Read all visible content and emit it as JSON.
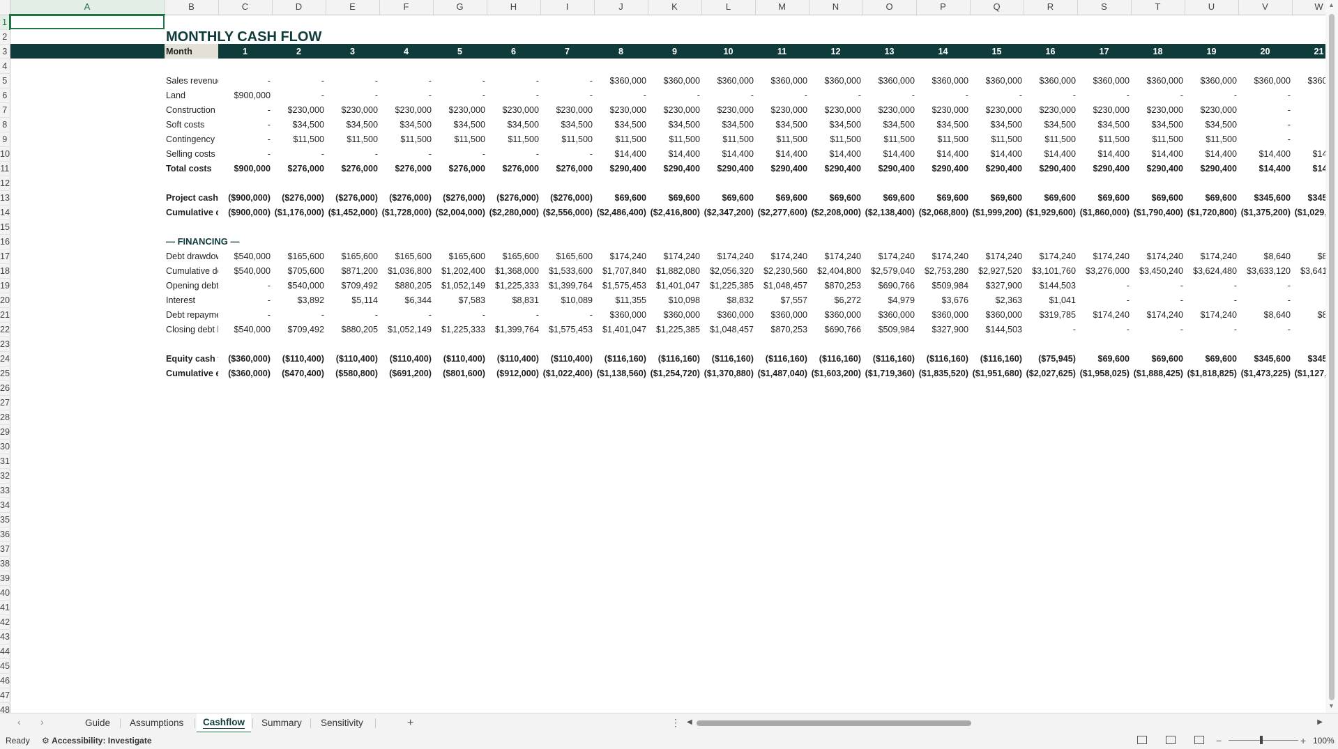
{
  "columns": [
    "A",
    "B",
    "C",
    "D",
    "E",
    "F",
    "G",
    "H",
    "I",
    "J",
    "K",
    "L",
    "M",
    "N",
    "O",
    "P",
    "Q",
    "R",
    "S",
    "T",
    "U",
    "V",
    "W"
  ],
  "title": "MONTHLY CASH FLOW",
  "header": {
    "label": "Month",
    "values": [
      "1",
      "2",
      "3",
      "4",
      "5",
      "6",
      "7",
      "8",
      "9",
      "10",
      "11",
      "12",
      "13",
      "14",
      "15",
      "16",
      "17",
      "18",
      "19",
      "20",
      "21"
    ],
    "overflow": ""
  },
  "rows": {
    "r5": {
      "label": "Sales revenue",
      "values": [
        "-",
        "-",
        "-",
        "-",
        "-",
        "-",
        "-",
        "$360,000",
        "$360,000",
        "$360,000",
        "$360,000",
        "$360,000",
        "$360,000",
        "$360,000",
        "$360,000",
        "$360,000",
        "$360,000",
        "$360,000",
        "$360,000",
        "$360,000",
        "$360,000"
      ],
      "overflow": "$3"
    },
    "r6": {
      "label": "Land",
      "values": [
        "$900,000",
        "-",
        "-",
        "-",
        "-",
        "-",
        "-",
        "-",
        "-",
        "-",
        "-",
        "-",
        "-",
        "-",
        "-",
        "-",
        "-",
        "-",
        "-",
        "-",
        "-"
      ],
      "overflow": ""
    },
    "r7": {
      "label": "Construction",
      "values": [
        "-",
        "$230,000",
        "$230,000",
        "$230,000",
        "$230,000",
        "$230,000",
        "$230,000",
        "$230,000",
        "$230,000",
        "$230,000",
        "$230,000",
        "$230,000",
        "$230,000",
        "$230,000",
        "$230,000",
        "$230,000",
        "$230,000",
        "$230,000",
        "$230,000",
        "-",
        "-"
      ],
      "overflow": ""
    },
    "r8": {
      "label": "Soft costs",
      "values": [
        "-",
        "$34,500",
        "$34,500",
        "$34,500",
        "$34,500",
        "$34,500",
        "$34,500",
        "$34,500",
        "$34,500",
        "$34,500",
        "$34,500",
        "$34,500",
        "$34,500",
        "$34,500",
        "$34,500",
        "$34,500",
        "$34,500",
        "$34,500",
        "$34,500",
        "-",
        "-"
      ],
      "overflow": ""
    },
    "r9": {
      "label": "Contingency",
      "values": [
        "-",
        "$11,500",
        "$11,500",
        "$11,500",
        "$11,500",
        "$11,500",
        "$11,500",
        "$11,500",
        "$11,500",
        "$11,500",
        "$11,500",
        "$11,500",
        "$11,500",
        "$11,500",
        "$11,500",
        "$11,500",
        "$11,500",
        "$11,500",
        "$11,500",
        "-",
        "-"
      ],
      "overflow": ""
    },
    "r10": {
      "label": "Selling costs",
      "values": [
        "-",
        "-",
        "-",
        "-",
        "-",
        "-",
        "-",
        "$14,400",
        "$14,400",
        "$14,400",
        "$14,400",
        "$14,400",
        "$14,400",
        "$14,400",
        "$14,400",
        "$14,400",
        "$14,400",
        "$14,400",
        "$14,400",
        "$14,400",
        "$14,400"
      ],
      "overflow": "$"
    },
    "r11": {
      "label": "Total costs",
      "values": [
        "$900,000",
        "$276,000",
        "$276,000",
        "$276,000",
        "$276,000",
        "$276,000",
        "$276,000",
        "$290,400",
        "$290,400",
        "$290,400",
        "$290,400",
        "$290,400",
        "$290,400",
        "$290,400",
        "$290,400",
        "$290,400",
        "$290,400",
        "$290,400",
        "$290,400",
        "$14,400",
        "$14,400"
      ],
      "overflow": "$"
    },
    "r13": {
      "label": "Project cash flow (unlevered)",
      "values": [
        "($900,000)",
        "($276,000)",
        "($276,000)",
        "($276,000)",
        "($276,000)",
        "($276,000)",
        "($276,000)",
        "$69,600",
        "$69,600",
        "$69,600",
        "$69,600",
        "$69,600",
        "$69,600",
        "$69,600",
        "$69,600",
        "$69,600",
        "$69,600",
        "$69,600",
        "$69,600",
        "$345,600",
        "$345,600"
      ],
      "overflow": "$3"
    },
    "r14": {
      "label": "Cumulative cash flow (project)",
      "values": [
        "($900,000)",
        "($1,176,000)",
        "($1,452,000)",
        "($1,728,000)",
        "($2,004,000)",
        "($2,280,000)",
        "($2,556,000)",
        "($2,486,400)",
        "($2,416,800)",
        "($2,347,200)",
        "($2,277,600)",
        "($2,208,000)",
        "($2,138,400)",
        "($2,068,800)",
        "($1,999,200)",
        "($1,929,600)",
        "($1,860,000)",
        "($1,790,400)",
        "($1,720,800)",
        "($1,375,200)",
        "($1,029,600)"
      ],
      "overflow": "($6"
    },
    "r16": {
      "label": "— FINANCING —"
    },
    "r17": {
      "label": "Debt drawdown",
      "values": [
        "$540,000",
        "$165,600",
        "$165,600",
        "$165,600",
        "$165,600",
        "$165,600",
        "$165,600",
        "$174,240",
        "$174,240",
        "$174,240",
        "$174,240",
        "$174,240",
        "$174,240",
        "$174,240",
        "$174,240",
        "$174,240",
        "$174,240",
        "$174,240",
        "$174,240",
        "$8,640",
        "$8,640"
      ],
      "overflow": ""
    },
    "r18": {
      "label": "Cumulative debt drawn",
      "values": [
        "$540,000",
        "$705,600",
        "$871,200",
        "$1,036,800",
        "$1,202,400",
        "$1,368,000",
        "$1,533,600",
        "$1,707,840",
        "$1,882,080",
        "$2,056,320",
        "$2,230,560",
        "$2,404,800",
        "$2,579,040",
        "$2,753,280",
        "$2,927,520",
        "$3,101,760",
        "$3,276,000",
        "$3,450,240",
        "$3,624,480",
        "$3,633,120",
        "$3,641,760"
      ],
      "overflow": "$3,6"
    },
    "r19": {
      "label": "Opening debt balance",
      "values": [
        "-",
        "$540,000",
        "$709,492",
        "$880,205",
        "$1,052,149",
        "$1,225,333",
        "$1,399,764",
        "$1,575,453",
        "$1,401,047",
        "$1,225,385",
        "$1,048,457",
        "$870,253",
        "$690,766",
        "$509,984",
        "$327,900",
        "$144,503",
        "-",
        "-",
        "-",
        "-",
        "-"
      ],
      "overflow": ""
    },
    "r20": {
      "label": "Interest",
      "values": [
        "-",
        "$3,892",
        "$5,114",
        "$6,344",
        "$7,583",
        "$8,831",
        "$10,089",
        "$11,355",
        "$10,098",
        "$8,832",
        "$7,557",
        "$6,272",
        "$4,979",
        "$3,676",
        "$2,363",
        "$1,041",
        "-",
        "-",
        "-",
        "-",
        "-"
      ],
      "overflow": ""
    },
    "r21": {
      "label": "Debt repayment",
      "values": [
        "-",
        "-",
        "-",
        "-",
        "-",
        "-",
        "-",
        "$360,000",
        "$360,000",
        "$360,000",
        "$360,000",
        "$360,000",
        "$360,000",
        "$360,000",
        "$360,000",
        "$319,785",
        "$174,240",
        "$174,240",
        "$174,240",
        "$8,640",
        "$8,640"
      ],
      "overflow": ""
    },
    "r22": {
      "label": "Closing debt balance",
      "values": [
        "$540,000",
        "$709,492",
        "$880,205",
        "$1,052,149",
        "$1,225,333",
        "$1,399,764",
        "$1,575,453",
        "$1,401,047",
        "$1,225,385",
        "$1,048,457",
        "$870,253",
        "$690,766",
        "$509,984",
        "$327,900",
        "$144,503",
        "-",
        "-",
        "-",
        "-",
        "-",
        "-"
      ],
      "overflow": ""
    },
    "r24": {
      "label": "Equity cash flow (levered)",
      "values": [
        "($360,000)",
        "($110,400)",
        "($110,400)",
        "($110,400)",
        "($110,400)",
        "($110,400)",
        "($110,400)",
        "($116,160)",
        "($116,160)",
        "($116,160)",
        "($116,160)",
        "($116,160)",
        "($116,160)",
        "($116,160)",
        "($116,160)",
        "($75,945)",
        "$69,600",
        "$69,600",
        "$69,600",
        "$345,600",
        "$345,600"
      ],
      "overflow": "$3"
    },
    "r25": {
      "label": "Cumulative equity cash flow",
      "values": [
        "($360,000)",
        "($470,400)",
        "($580,800)",
        "($691,200)",
        "($801,600)",
        "($912,000)",
        "($1,022,400)",
        "($1,138,560)",
        "($1,254,720)",
        "($1,370,880)",
        "($1,487,040)",
        "($1,603,200)",
        "($1,719,360)",
        "($1,835,520)",
        "($1,951,680)",
        "($2,027,625)",
        "($1,958,025)",
        "($1,888,425)",
        "($1,818,825)",
        "($1,473,225)",
        "($1,127,625)"
      ],
      "overflow": "($7"
    }
  },
  "sheet_tabs": [
    "Guide",
    "Assumptions",
    "Cashflow",
    "Summary",
    "Sensitivity"
  ],
  "active_tab": "Cashflow",
  "add_sheet": "+",
  "status": {
    "ready": "Ready",
    "accessibility": "Accessibility: Investigate",
    "zoom": "100%"
  },
  "colors": {
    "header_fill": "#0f3b3b",
    "accent": "#217346",
    "label_fill": "#e3e0d8"
  }
}
